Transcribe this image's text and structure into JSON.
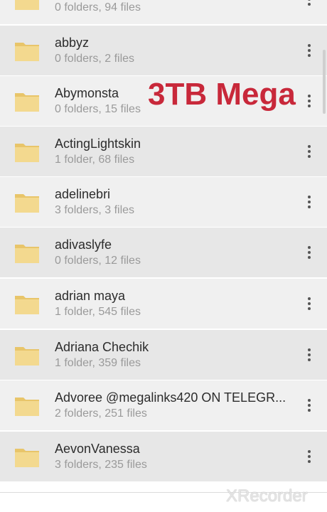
{
  "overlay": {
    "title": "3TB Mega",
    "color": "#c8283a"
  },
  "watermark": {
    "text": "XRecorder"
  },
  "folders": [
    {
      "name": "",
      "meta": "0 folders, 94 files"
    },
    {
      "name": "abbyz",
      "meta": "0 folders, 2 files"
    },
    {
      "name": "Abymonsta",
      "meta": "0 folders, 15 files"
    },
    {
      "name": "ActingLightskin",
      "meta": "1 folder, 68 files"
    },
    {
      "name": "adelinebri",
      "meta": "3 folders, 3 files"
    },
    {
      "name": "adivaslyfe",
      "meta": "0 folders, 12 files"
    },
    {
      "name": "adrian maya",
      "meta": "1 folder, 545 files"
    },
    {
      "name": "Adriana Chechik",
      "meta": "1 folder, 359 files"
    },
    {
      "name": "Advoree @megalinks420 ON TELEGR...",
      "meta": "2 folders, 251 files"
    },
    {
      "name": "AevonVanessa",
      "meta": "3 folders, 235 files"
    }
  ],
  "icons": {
    "folder": "folder-icon",
    "more": "more-vertical-icon"
  },
  "colors": {
    "folder": "#f3d98f",
    "folder_dark": "#e8c56a",
    "row_shade": "#e7e7e7",
    "row_light": "#f0f0f0"
  }
}
